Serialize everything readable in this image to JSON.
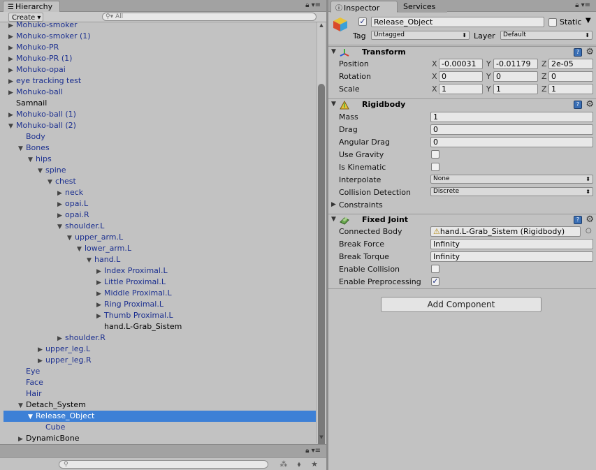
{
  "hierarchy": {
    "tab_label": "Hierarchy",
    "create_label": "Create ▾",
    "search_placeholder": "All",
    "rows": [
      {
        "label": "Mohuko-smoker",
        "depth": 0,
        "arrow": "▶",
        "kind": "prefab"
      },
      {
        "label": "Mohuko-smoker (1)",
        "depth": 0,
        "arrow": "▶",
        "kind": "prefab"
      },
      {
        "label": "Mohuko-PR",
        "depth": 0,
        "arrow": "▶",
        "kind": "prefab"
      },
      {
        "label": "Mohuko-PR (1)",
        "depth": 0,
        "arrow": "▶",
        "kind": "prefab"
      },
      {
        "label": "Mohuko-opai",
        "depth": 0,
        "arrow": "▶",
        "kind": "prefab"
      },
      {
        "label": "eye tracking test",
        "depth": 0,
        "arrow": "▶",
        "kind": "prefab"
      },
      {
        "label": "Mohuko-ball",
        "depth": 0,
        "arrow": "▶",
        "kind": "prefab"
      },
      {
        "label": "Samnail",
        "depth": 0,
        "arrow": "",
        "kind": "plain"
      },
      {
        "label": "Mohuko-ball (1)",
        "depth": 0,
        "arrow": "▶",
        "kind": "prefab"
      },
      {
        "label": "Mohuko-ball (2)",
        "depth": 0,
        "arrow": "▼",
        "kind": "prefab"
      },
      {
        "label": "Body",
        "depth": 1,
        "arrow": "",
        "kind": "prefab"
      },
      {
        "label": "Bones",
        "depth": 1,
        "arrow": "▼",
        "kind": "prefab"
      },
      {
        "label": "hips",
        "depth": 2,
        "arrow": "▼",
        "kind": "prefab"
      },
      {
        "label": "spine",
        "depth": 3,
        "arrow": "▼",
        "kind": "prefab"
      },
      {
        "label": "chest",
        "depth": 4,
        "arrow": "▼",
        "kind": "prefab"
      },
      {
        "label": "neck",
        "depth": 5,
        "arrow": "▶",
        "kind": "prefab"
      },
      {
        "label": "opai.L",
        "depth": 5,
        "arrow": "▶",
        "kind": "prefab"
      },
      {
        "label": "opai.R",
        "depth": 5,
        "arrow": "▶",
        "kind": "prefab"
      },
      {
        "label": "shoulder.L",
        "depth": 5,
        "arrow": "▼",
        "kind": "prefab"
      },
      {
        "label": "upper_arm.L",
        "depth": 6,
        "arrow": "▼",
        "kind": "prefab"
      },
      {
        "label": "lower_arm.L",
        "depth": 7,
        "arrow": "▼",
        "kind": "prefab"
      },
      {
        "label": "hand.L",
        "depth": 8,
        "arrow": "▼",
        "kind": "prefab"
      },
      {
        "label": "Index Proximal.L",
        "depth": 9,
        "arrow": "▶",
        "kind": "prefab"
      },
      {
        "label": "Little Proximal.L",
        "depth": 9,
        "arrow": "▶",
        "kind": "prefab"
      },
      {
        "label": "Middle Proximal.L",
        "depth": 9,
        "arrow": "▶",
        "kind": "prefab"
      },
      {
        "label": "Ring Proximal.L",
        "depth": 9,
        "arrow": "▶",
        "kind": "prefab"
      },
      {
        "label": "Thumb Proximal.L",
        "depth": 9,
        "arrow": "▶",
        "kind": "prefab"
      },
      {
        "label": "hand.L-Grab_Sistem",
        "depth": 9,
        "arrow": "",
        "kind": "plain"
      },
      {
        "label": "shoulder.R",
        "depth": 5,
        "arrow": "▶",
        "kind": "prefab"
      },
      {
        "label": "upper_leg.L",
        "depth": 3,
        "arrow": "▶",
        "kind": "prefab"
      },
      {
        "label": "upper_leg.R",
        "depth": 3,
        "arrow": "▶",
        "kind": "prefab"
      },
      {
        "label": "Eye",
        "depth": 1,
        "arrow": "",
        "kind": "prefab"
      },
      {
        "label": "Face",
        "depth": 1,
        "arrow": "",
        "kind": "prefab"
      },
      {
        "label": "Hair",
        "depth": 1,
        "arrow": "",
        "kind": "prefab"
      },
      {
        "label": "Detach_System",
        "depth": 1,
        "arrow": "▼",
        "kind": "plain"
      },
      {
        "label": "Release_Object",
        "depth": 2,
        "arrow": "▼",
        "kind": "prefab",
        "selected": true
      },
      {
        "label": "Cube",
        "depth": 3,
        "arrow": "",
        "kind": "prefab"
      },
      {
        "label": "DynamicBone",
        "depth": 1,
        "arrow": "▶",
        "kind": "plain"
      }
    ]
  },
  "inspector": {
    "tab_label": "Inspector",
    "services_label": "Services",
    "object_name": "Release_Object",
    "static_label": "Static",
    "tag_label": "Tag",
    "tag_value": "Untagged",
    "layer_label": "Layer",
    "layer_value": "Default",
    "transform": {
      "title": "Transform",
      "position_label": "Position",
      "rotation_label": "Rotation",
      "scale_label": "Scale",
      "position": {
        "x": "-0.00031",
        "y": "-0.01179",
        "z": "2e-05"
      },
      "rotation": {
        "x": "0",
        "y": "0",
        "z": "0"
      },
      "scale": {
        "x": "1",
        "y": "1",
        "z": "1"
      }
    },
    "rigidbody": {
      "title": "Rigidbody",
      "mass_label": "Mass",
      "mass": "1",
      "drag_label": "Drag",
      "drag": "0",
      "angular_drag_label": "Angular Drag",
      "angular_drag": "0",
      "use_gravity_label": "Use Gravity",
      "is_kinematic_label": "Is Kinematic",
      "interpolate_label": "Interpolate",
      "interpolate": "None",
      "collision_label": "Collision Detection",
      "collision": "Discrete",
      "constraints_label": "Constraints"
    },
    "fixed_joint": {
      "title": "Fixed Joint",
      "connected_body_label": "Connected Body",
      "connected_body": "hand.L-Grab_Sistem (Rigidbody)",
      "break_force_label": "Break Force",
      "break_force": "Infinity",
      "break_torque_label": "Break Torque",
      "break_torque": "Infinity",
      "enable_collision_label": "Enable Collision",
      "enable_preprocessing_label": "Enable Preprocessing"
    },
    "add_component_label": "Add Component"
  }
}
